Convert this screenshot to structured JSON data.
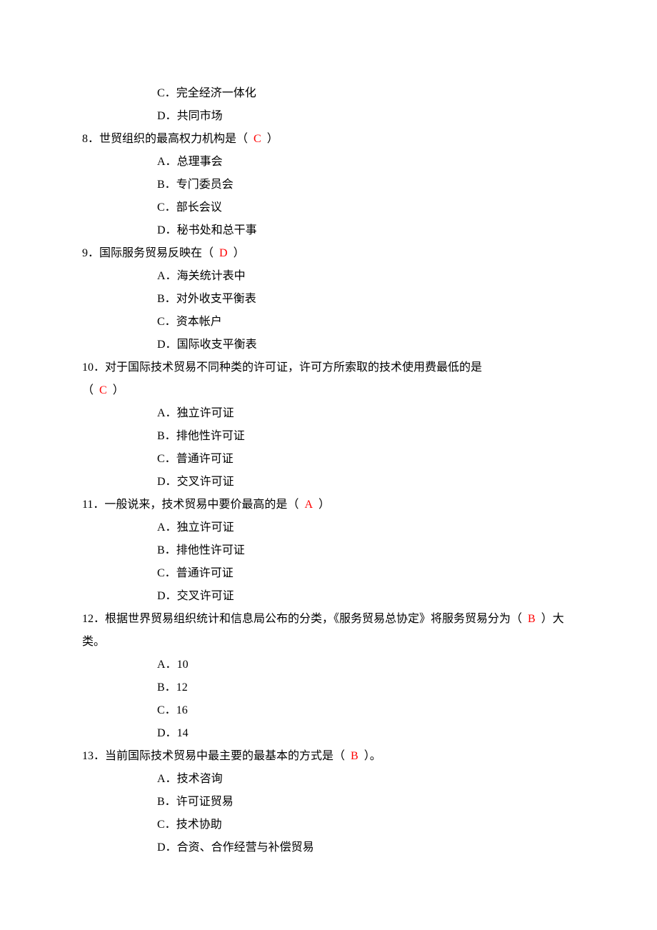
{
  "continuation_options": [
    {
      "label": "C．",
      "text": "完全经济一体化"
    },
    {
      "label": "D．",
      "text": "共同市场"
    }
  ],
  "questions": [
    {
      "number": "8．",
      "stem": "世贸组织的最高权力机构是",
      "answer": "C",
      "options": [
        {
          "label": "A．",
          "text": "总理事会"
        },
        {
          "label": "B．",
          "text": "专门委员会"
        },
        {
          "label": "C．",
          "text": "部长会议"
        },
        {
          "label": "D．",
          "text": "秘书处和总干事"
        }
      ]
    },
    {
      "number": "9．",
      "stem": "国际服务贸易反映在",
      "answer": "D",
      "options": [
        {
          "label": "A．",
          "text": "海关统计表中"
        },
        {
          "label": "B．",
          "text": "对外收支平衡表"
        },
        {
          "label": "C．",
          "text": "资本帐户"
        },
        {
          "label": "D．",
          "text": "国际收支平衡表"
        }
      ]
    },
    {
      "number": "10．",
      "stem_pre": "对于国际技术贸易不同种类的许可证，许可方所索取的技术使用费最低的是",
      "answer": "C",
      "options": [
        {
          "label": "A．",
          "text": "独立许可证"
        },
        {
          "label": "B．",
          "text": "排他性许可证"
        },
        {
          "label": "C．",
          "text": "普通许可证"
        },
        {
          "label": "D．",
          "text": "交叉许可证"
        }
      ]
    },
    {
      "number": "11．",
      "stem": "一般说来，技术贸易中要价最高的是",
      "answer": "A",
      "options": [
        {
          "label": "A．",
          "text": "独立许可证"
        },
        {
          "label": "B．",
          "text": "排他性许可证"
        },
        {
          "label": "C．",
          "text": "普通许可证"
        },
        {
          "label": "D．",
          "text": "交叉许可证"
        }
      ]
    },
    {
      "number": "12．",
      "stem_pre": "根据世界贸易组织统计和信息局公布的分类，《服务贸易总协定》将服务贸易分为",
      "stem_post": "大类。",
      "answer": "B",
      "options": [
        {
          "label": "A．",
          "text": "10"
        },
        {
          "label": "B．",
          "text": "12"
        },
        {
          "label": "C．",
          "text": "16"
        },
        {
          "label": "D．",
          "text": "14"
        }
      ]
    },
    {
      "number": "13．",
      "stem": "当前国际技术贸易中最主要的最基本的方式是",
      "stem_post": "。",
      "answer": "B",
      "options": [
        {
          "label": "A．",
          "text": "技术咨询"
        },
        {
          "label": "B．",
          "text": "许可证贸易"
        },
        {
          "label": "C．",
          "text": "技术协助"
        },
        {
          "label": "D．",
          "text": "合资、合作经营与补偿贸易"
        }
      ]
    }
  ]
}
